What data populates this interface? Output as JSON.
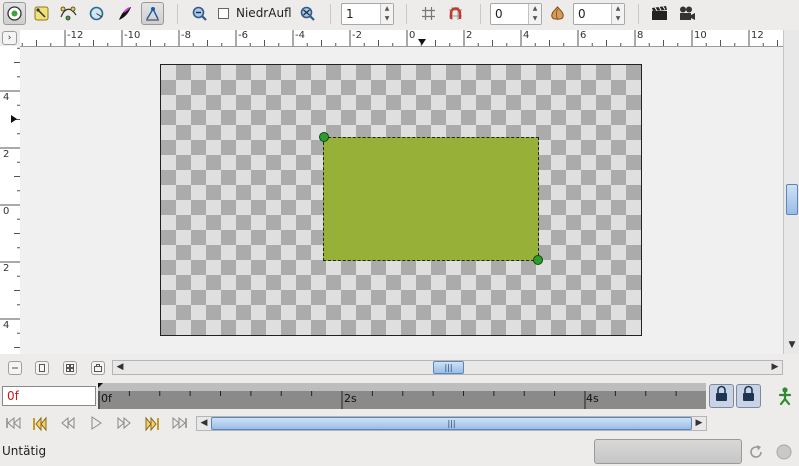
{
  "toolbar": {
    "tools": [
      {
        "name": "transform-tool-icon",
        "active": true
      },
      {
        "name": "smooth-move-tool-icon",
        "active": false
      },
      {
        "name": "vertex-tool-icon",
        "active": false
      },
      {
        "name": "circle-tool-icon",
        "active": false
      },
      {
        "name": "feather-tool-icon",
        "active": false
      },
      {
        "name": "draw-tool-icon",
        "active": true
      }
    ],
    "lowres_label": "NiedrAufl",
    "lowres_checked": false,
    "quality_value": "1",
    "onion_past_value": "0",
    "onion_future_value": "0"
  },
  "rulers": {
    "horizontal_labels": [
      "-12",
      "-10",
      "-8",
      "-6",
      "-4",
      "-2",
      "0",
      "2",
      "4",
      "6",
      "8",
      "10",
      "12"
    ],
    "vertical_labels": [
      "4",
      "2",
      "0",
      "2",
      "4"
    ]
  },
  "canvas": {
    "artboard_color": "#dfdfdf",
    "checker_color": "#ababab",
    "shape_color": "#97b038",
    "handle_color": "#2d9c2d"
  },
  "timebar": {
    "current_time": "0f",
    "labels": [
      "0f",
      "2s",
      "4s"
    ]
  },
  "status": {
    "text": "Untätig"
  }
}
